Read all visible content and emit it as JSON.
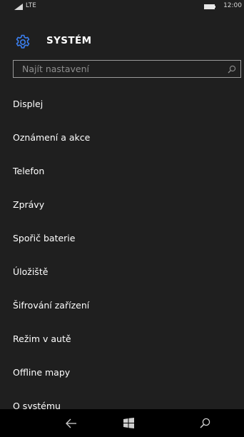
{
  "status_bar": {
    "signal_icon": "signal-bars-icon",
    "network": "LTE",
    "battery_icon": "battery-icon",
    "time": "12:00"
  },
  "header": {
    "icon": "gear-icon",
    "title": "SYSTÉM"
  },
  "search": {
    "placeholder": "Najít nastavení",
    "icon": "search-icon"
  },
  "items": [
    {
      "label": "Displej"
    },
    {
      "label": "Oznámení a akce"
    },
    {
      "label": "Telefon"
    },
    {
      "label": "Zprávy"
    },
    {
      "label": "Spořič baterie"
    },
    {
      "label": "Úložiště"
    },
    {
      "label": "Šifrování zařízení"
    },
    {
      "label": "Režim v autě"
    },
    {
      "label": "Offline mapy"
    },
    {
      "label": "O systému"
    }
  ],
  "nav_bar": {
    "back_icon": "back-arrow-icon",
    "start_icon": "windows-logo-icon",
    "search_icon": "search-icon"
  },
  "colors": {
    "accent": "#3b7ff0",
    "background": "#1f1f1f",
    "nav_background": "#000000",
    "text": "#ffffff"
  }
}
